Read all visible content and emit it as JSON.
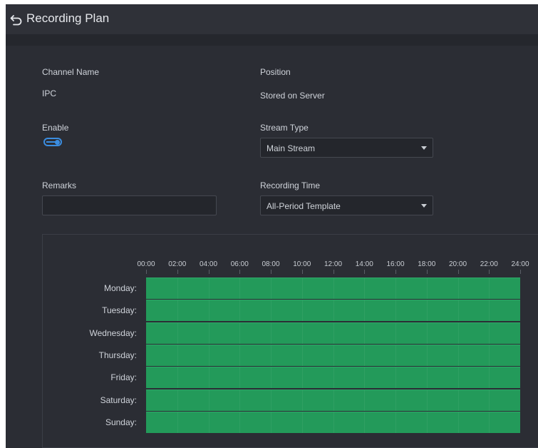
{
  "header": {
    "title": "Recording Plan"
  },
  "form": {
    "channel_name_label": "Channel Name",
    "channel_name_value": "IPC",
    "position_label": "Position",
    "position_value": "Stored on Server",
    "enable_label": "Enable",
    "enable_on": true,
    "stream_type_label": "Stream Type",
    "stream_type_value": "Main Stream",
    "remarks_label": "Remarks",
    "remarks_value": "",
    "recording_time_label": "Recording Time",
    "recording_time_value": "All-Period Template"
  },
  "schedule": {
    "time_labels": [
      "00:00",
      "02:00",
      "04:00",
      "06:00",
      "08:00",
      "10:00",
      "12:00",
      "14:00",
      "16:00",
      "18:00",
      "20:00",
      "22:00",
      "24:00"
    ],
    "days": [
      {
        "label": "Monday:",
        "start": "00:00",
        "end": "24:00"
      },
      {
        "label": "Tuesday:",
        "start": "00:00",
        "end": "24:00"
      },
      {
        "label": "Wednesday:",
        "start": "00:00",
        "end": "24:00"
      },
      {
        "label": "Thursday:",
        "start": "00:00",
        "end": "24:00"
      },
      {
        "label": "Friday:",
        "start": "00:00",
        "end": "24:00"
      },
      {
        "label": "Saturday:",
        "start": "00:00",
        "end": "24:00"
      },
      {
        "label": "Sunday:",
        "start": "00:00",
        "end": "24:00"
      }
    ],
    "fill_color": "#239a5a"
  },
  "colors": {
    "background": "#2b2d34",
    "accent": "#3b8de0",
    "recording": "#239a5a"
  },
  "icons": {
    "back": "back-arrow-icon",
    "dropdown": "chevron-down-icon"
  }
}
